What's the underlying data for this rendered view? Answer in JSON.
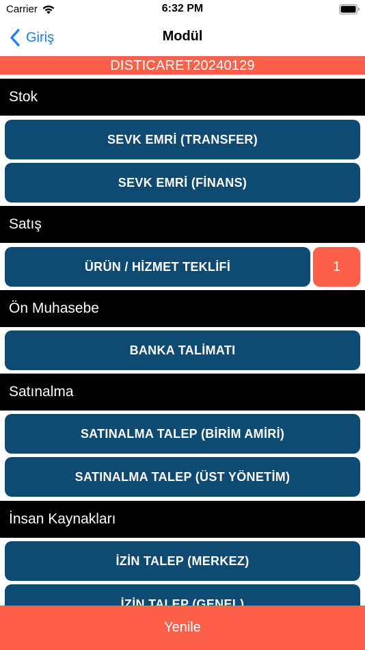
{
  "status_bar": {
    "carrier": "Carrier",
    "time": "6:32 PM"
  },
  "nav": {
    "back_label": "Giriş",
    "title": "Modül"
  },
  "banner": {
    "code": "DISTICARET20240129"
  },
  "sections": {
    "stok": {
      "title": "Stok",
      "buttons": [
        "SEVK EMRİ (TRANSFER)",
        "SEVK EMRİ (FİNANS)"
      ]
    },
    "satis": {
      "title": "Satış",
      "buttons": [
        "ÜRÜN / HİZMET TEKLİFİ"
      ],
      "badge": "1"
    },
    "on_muhasebe": {
      "title": "Ön Muhasebe",
      "buttons": [
        "BANKA TALİMATI"
      ]
    },
    "satinalma": {
      "title": "Satınalma",
      "buttons": [
        "SATINALMA TALEP (BİRİM AMİRİ)",
        "SATINALMA TALEP (ÜST YÖNETİM)"
      ]
    },
    "insan_kaynaklari": {
      "title": "İnsan Kaynakları",
      "buttons": [
        "İZİN TALEP (MERKEZ)",
        "İZİN TALEP (GENEL)"
      ]
    }
  },
  "footer": {
    "refresh_label": "Yenile"
  },
  "colors": {
    "accent": "#fd614a",
    "button": "#0f4a72",
    "section_header": "#000000",
    "link": "#1a7cf2"
  },
  "icons": {
    "wifi": "wifi-icon",
    "battery": "battery-icon",
    "back": "back-chevron-icon"
  }
}
